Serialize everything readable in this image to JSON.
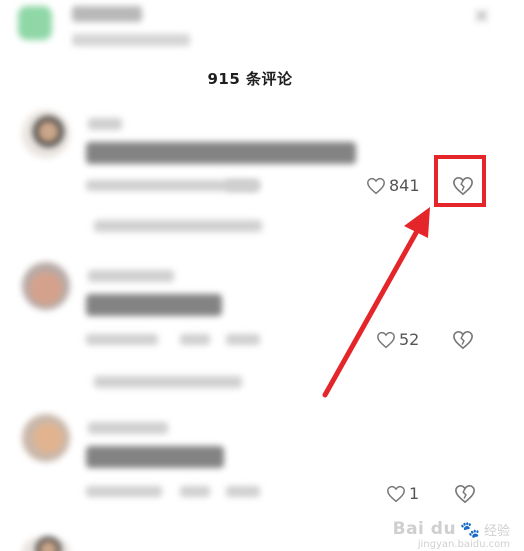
{
  "header": {
    "comment_count_title": "915 条评论"
  },
  "comments": [
    {
      "likes": "841"
    },
    {
      "likes": "52"
    },
    {
      "likes": "1"
    }
  ],
  "colors": {
    "highlight": "#e4262a",
    "text": "#555555"
  },
  "icons": {
    "like": "heart-outline-icon",
    "dislike": "broken-heart-icon"
  },
  "watermark": {
    "brand": "Bai du",
    "suffix": "经验",
    "domain": "jingyan.baidu.com"
  }
}
